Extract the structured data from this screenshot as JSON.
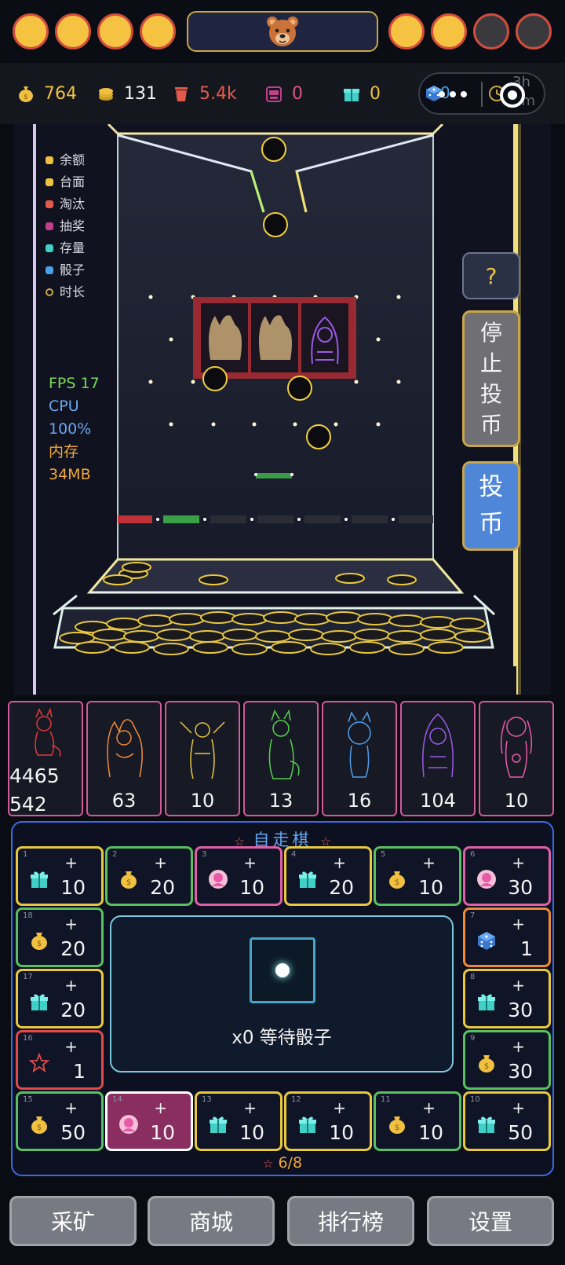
{
  "header": {
    "coin_slots_left": [
      "on",
      "on",
      "on",
      "on"
    ],
    "coin_slots_right": [
      "on",
      "on",
      "off",
      "off"
    ],
    "avatar_icon": "bear-icon"
  },
  "stats": {
    "balance": {
      "icon": "money-bag-icon",
      "value": "764",
      "color": "#f0c040"
    },
    "table": {
      "icon": "coin-stack-icon",
      "value": "131",
      "color": "#f4f4f4"
    },
    "eliminated": {
      "icon": "trash-icon",
      "value": "5.4k",
      "color": "#e45a4a"
    },
    "lottery": {
      "icon": "lottery-machine-icon",
      "value": "0",
      "color": "#e0508c"
    },
    "stock": {
      "icon": "gift-icon",
      "value": "0",
      "color": "#f0c040"
    },
    "dice": {
      "icon": "dice-icon",
      "value": "0"
    },
    "duration": {
      "icon": "clock-icon",
      "value_hours": "3h",
      "value_minutes": "9m"
    }
  },
  "legend": [
    {
      "label": "余额",
      "color": "#f0c040"
    },
    {
      "label": "台面",
      "color": "#f0c040"
    },
    {
      "label": "淘汰",
      "color": "#e45a4a"
    },
    {
      "label": "抽奖",
      "color": "#c0408c"
    },
    {
      "label": "存量",
      "color": "#40d0c8"
    },
    {
      "label": "骰子",
      "color": "#4aa0e8"
    },
    {
      "label": "时长",
      "color": "#c9a64a"
    }
  ],
  "perf": {
    "fps": "FPS 17",
    "cpu_label": "CPU",
    "cpu_value": "100%",
    "mem_label": "内存",
    "mem_value": "34MB"
  },
  "buttons": {
    "help": "?",
    "stop": [
      "停",
      "止",
      "投",
      "币"
    ],
    "insert": [
      "投",
      "币"
    ]
  },
  "cards": [
    {
      "big1": "4465",
      "big2": "542",
      "color": "#e03a3a"
    },
    {
      "count": "63",
      "color": "#f08a3a"
    },
    {
      "count": "10",
      "color": "#e8c840"
    },
    {
      "count": "13",
      "color": "#58d050"
    },
    {
      "count": "16",
      "color": "#50a0f0"
    },
    {
      "count": "104",
      "color": "#9a5ae8"
    },
    {
      "count": "10",
      "color": "#e85aa8"
    }
  ],
  "board": {
    "title": "自走棋",
    "center_text": "x0 等待骰子",
    "progress": "6/8",
    "tiles": [
      {
        "num": "1",
        "icon": "gift-icon",
        "plus": "+",
        "value": "10",
        "border": "#e8c840"
      },
      {
        "num": "2",
        "icon": "money-bag-icon",
        "plus": "+",
        "value": "20",
        "border": "#58c060"
      },
      {
        "num": "3",
        "icon": "avatar-icon",
        "plus": "+",
        "value": "10",
        "border": "#e060a8"
      },
      {
        "num": "4",
        "icon": "gift-icon",
        "plus": "+",
        "value": "20",
        "border": "#e8c840"
      },
      {
        "num": "5",
        "icon": "money-bag-icon",
        "plus": "+",
        "value": "10",
        "border": "#58c060"
      },
      {
        "num": "6",
        "icon": "avatar-icon",
        "plus": "+",
        "value": "30",
        "border": "#e060a8"
      },
      {
        "num": "7",
        "icon": "dice-icon",
        "plus": "+",
        "value": "1",
        "border": "#f08a3a"
      },
      {
        "num": "8",
        "icon": "gift-icon",
        "plus": "+",
        "value": "30",
        "border": "#e8c840"
      },
      {
        "num": "9",
        "icon": "money-bag-icon",
        "plus": "+",
        "value": "30",
        "border": "#58c060"
      },
      {
        "num": "10",
        "icon": "gift-icon",
        "plus": "+",
        "value": "50",
        "border": "#e8c840"
      },
      {
        "num": "11",
        "icon": "money-bag-icon",
        "plus": "+",
        "value": "10",
        "border": "#58c060"
      },
      {
        "num": "12",
        "icon": "gift-icon",
        "plus": "+",
        "value": "10",
        "border": "#e8c840"
      },
      {
        "num": "13",
        "icon": "gift-icon",
        "plus": "+",
        "value": "10",
        "border": "#e8c840"
      },
      {
        "num": "14",
        "icon": "avatar-icon",
        "plus": "+",
        "value": "10",
        "border": "#ffffff"
      },
      {
        "num": "15",
        "icon": "money-bag-icon",
        "plus": "+",
        "value": "50",
        "border": "#58c060"
      },
      {
        "num": "16",
        "icon": "star-icon",
        "plus": "+",
        "value": "1",
        "border": "#e04a4a"
      },
      {
        "num": "17",
        "icon": "gift-icon",
        "plus": "+",
        "value": "20",
        "border": "#e8c840"
      },
      {
        "num": "18",
        "icon": "money-bag-icon",
        "plus": "+",
        "value": "20",
        "border": "#58c060"
      }
    ]
  },
  "nav": [
    "采矿",
    "商城",
    "排行榜",
    "设置"
  ]
}
